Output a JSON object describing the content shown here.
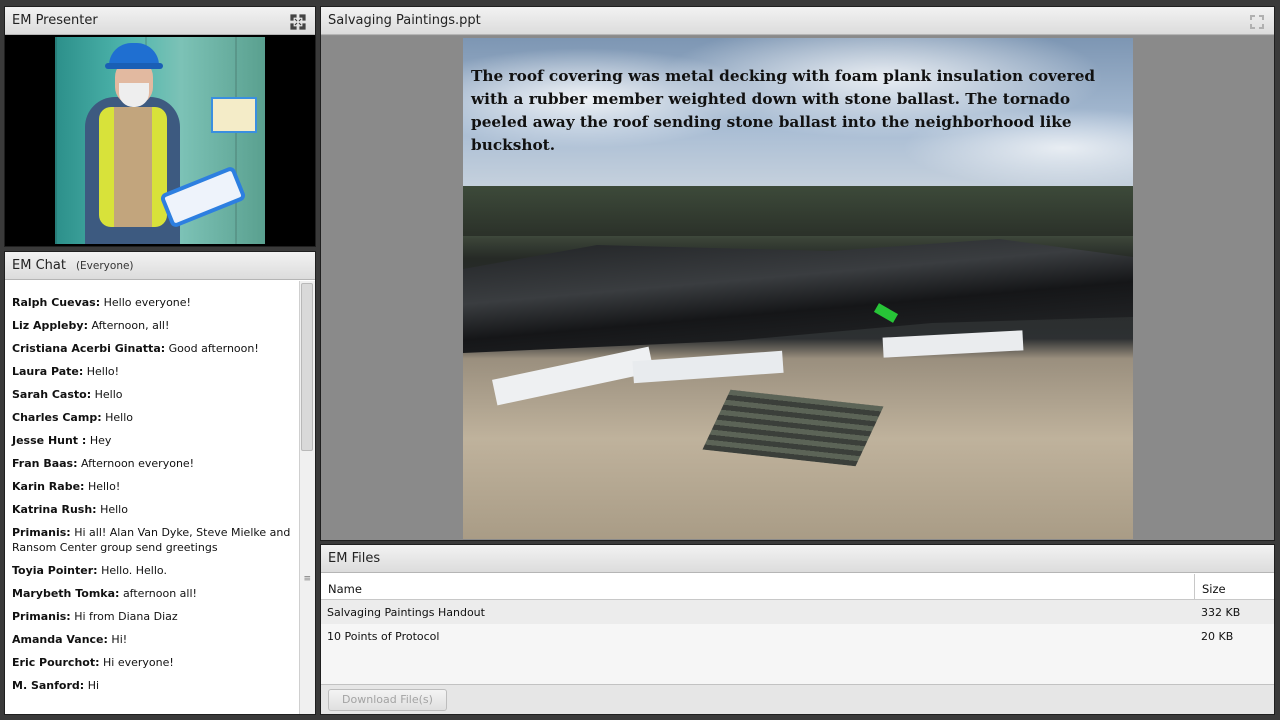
{
  "presenter": {
    "title": "EM Presenter",
    "fullscreen_icon": "fullscreen-icon"
  },
  "chat": {
    "title": "EM Chat",
    "audience": "(Everyone)",
    "messages": [
      {
        "who": "Ralph Cuevas",
        "text": "Hello everyone!"
      },
      {
        "who": "Liz Appleby",
        "text": "Afternoon, all!"
      },
      {
        "who": "Cristiana Acerbi Ginatta",
        "text": "Good afternoon!"
      },
      {
        "who": "Laura Pate",
        "text": "Hello!"
      },
      {
        "who": "Sarah Casto",
        "text": "Hello"
      },
      {
        "who": "Charles Camp",
        "text": "Hello"
      },
      {
        "who": "Jesse  Hunt ",
        "text": "Hey"
      },
      {
        "who": "Fran Baas",
        "text": "Afternoon everyone!"
      },
      {
        "who": "Karin Rabe",
        "text": "Hello!"
      },
      {
        "who": "Katrina Rush",
        "text": "Hello"
      },
      {
        "who": "Primanis",
        "text": "Hi all! Alan Van Dyke, Steve Mielke and Ransom Center group send greetings"
      },
      {
        "who": "Toyia Pointer",
        "text": "Hello. Hello."
      },
      {
        "who": "Marybeth Tomka",
        "text": "afternoon all!"
      },
      {
        "who": "Primanis",
        "text": "Hi from Diana Diaz"
      },
      {
        "who": "Amanda Vance",
        "text": "Hi!"
      },
      {
        "who": "Eric Pourchot",
        "text": "Hi everyone!"
      },
      {
        "who": "M. Sanford",
        "text": "Hi"
      }
    ]
  },
  "share": {
    "title": "Salvaging Paintings.ppt",
    "slide_text": "The roof covering was metal decking with foam plank insulation covered with a rubber member weighted down with stone ballast.  The tornado peeled away the roof sending stone ballast into the neighborhood like buckshot."
  },
  "files": {
    "title": "EM Files",
    "columns": {
      "name": "Name",
      "size": "Size"
    },
    "rows": [
      {
        "name": "Salvaging Paintings Handout",
        "size": "332 KB"
      },
      {
        "name": "10 Points of Protocol",
        "size": "20 KB"
      }
    ],
    "download_label": "Download File(s)"
  }
}
